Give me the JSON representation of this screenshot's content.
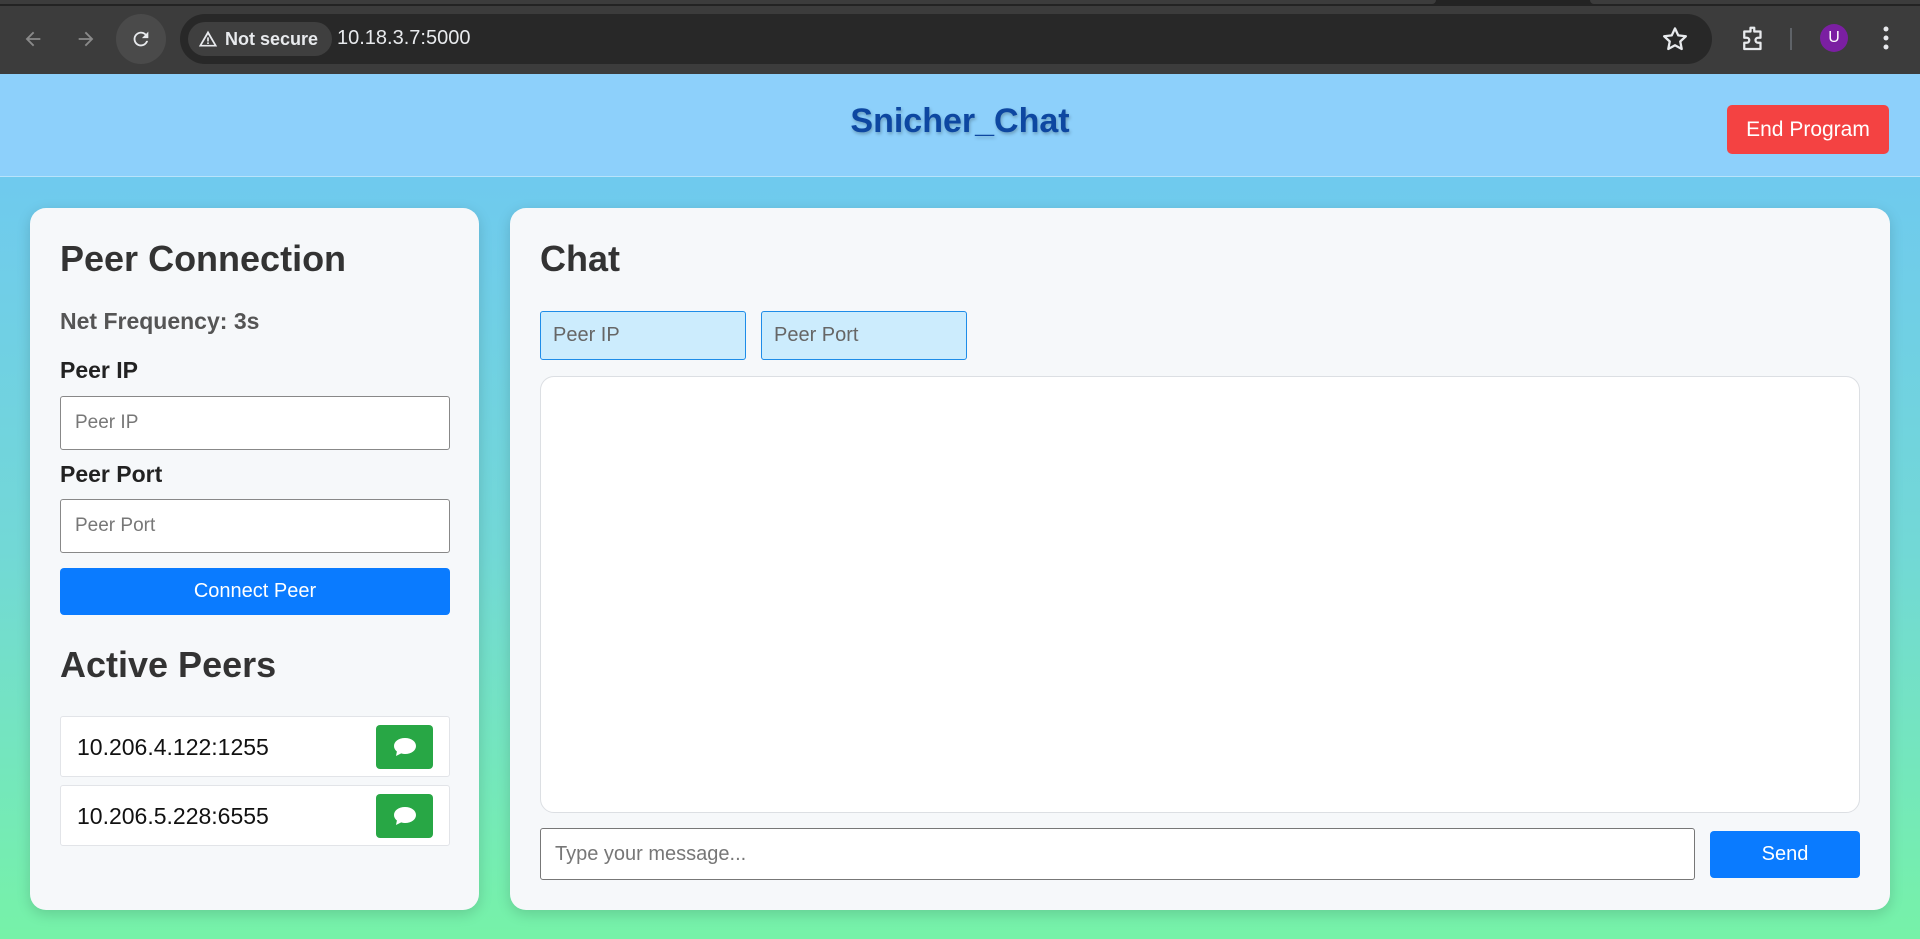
{
  "browser": {
    "security_label": "Not secure",
    "url": "10.18.3.7:5000",
    "profile_initial": "U",
    "icons": [
      "back-icon",
      "forward-icon",
      "reload-icon",
      "warning-icon",
      "star-icon",
      "extensions-icon",
      "more-icon"
    ]
  },
  "header": {
    "title": "Snicher_Chat",
    "end_button": "End Program",
    "end_button_color": "#f44242"
  },
  "peer_panel": {
    "title": "Peer Connection",
    "net_frequency": "Net Frequency: 3s",
    "ip_label": "Peer IP",
    "ip_placeholder": "Peer IP",
    "port_label": "Peer Port",
    "port_placeholder": "Peer Port",
    "connect_button": "Connect Peer",
    "active_title": "Active Peers",
    "active_peers": [
      {
        "address": "10.206.4.122:1255",
        "icon": "chat-bubble-icon"
      },
      {
        "address": "10.206.5.228:6555",
        "icon": "chat-bubble-icon"
      }
    ]
  },
  "chat_panel": {
    "title": "Chat",
    "peer_ip_placeholder": "Peer IP",
    "peer_port_placeholder": "Peer Port",
    "message_placeholder": "Type your message...",
    "send_button": "Send"
  },
  "colors": {
    "primary": "#0a7bff",
    "success": "#28a745",
    "danger": "#f44242",
    "title": "#0d47a1"
  }
}
